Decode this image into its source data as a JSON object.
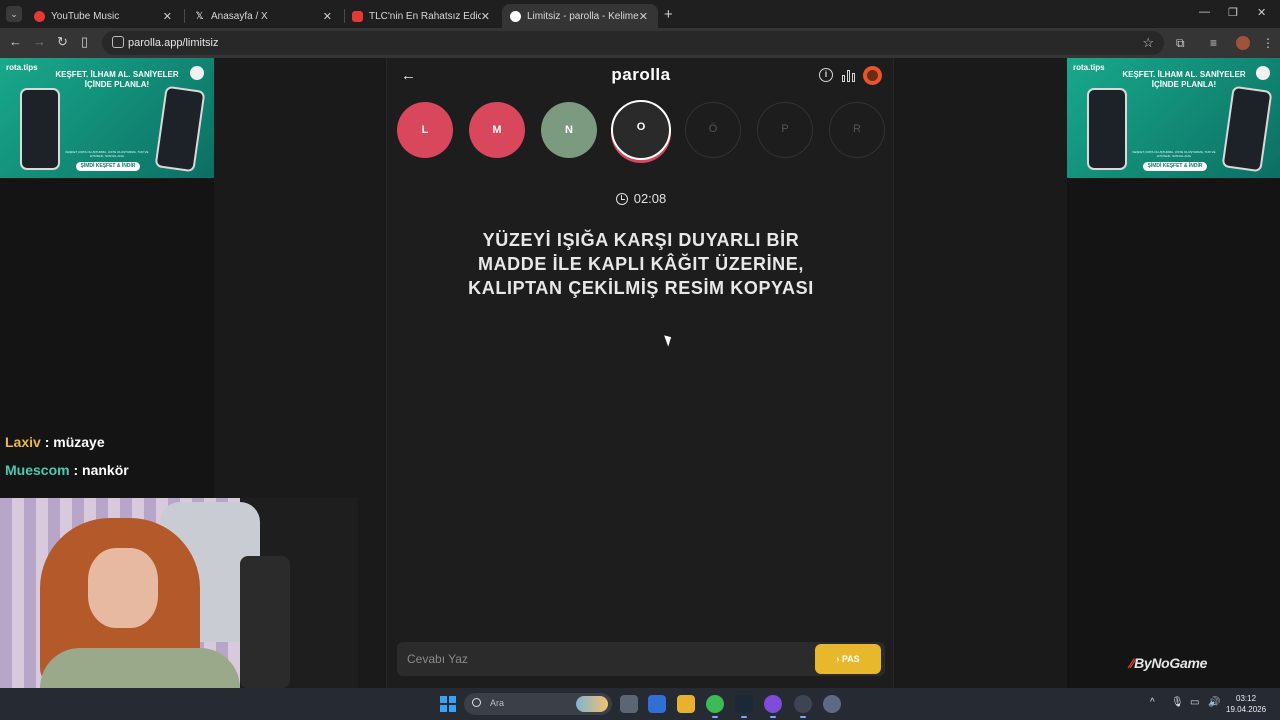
{
  "browser": {
    "tabs": [
      {
        "title": "YouTube Music",
        "color": "#e53935"
      },
      {
        "title": "Anasayfa / X",
        "color": "#ffffff"
      },
      {
        "title": "TLC'nin En Rahatsız Edici Progr",
        "color": "#e53935"
      },
      {
        "title": "Limitsiz - parolla - Kelime oyunu",
        "color": "#ffffff"
      }
    ],
    "url": "parolla.app/limitsiz"
  },
  "ad": {
    "brand": "rota.tips",
    "headline": "KEŞFET. İLHAM AL. SANİYELER İÇİNDE PLANLA!",
    "sub": "KEŞFET, ROTA OLUŞTURMA, LİSTE OLUŞTURMA, TUR VE ETKİNLİK, SOSYAL ANG",
    "cta": "ŞİMDİ KEŞFET & İNDİR"
  },
  "game": {
    "logo": "parolla",
    "letters": [
      {
        "letter": "L",
        "state": "wrong"
      },
      {
        "letter": "M",
        "state": "wrong"
      },
      {
        "letter": "N",
        "state": "right"
      },
      {
        "letter": "O",
        "state": "current"
      },
      {
        "letter": "Ö",
        "state": "pending"
      },
      {
        "letter": "P",
        "state": "pending"
      },
      {
        "letter": "R",
        "state": "pending"
      }
    ],
    "timer": "02:08",
    "question_lines": [
      "YÜZEYİ IŞIĞA KARŞI DUYARLI BİR",
      "MADDE İLE KAPLI KÂĞIT ÜZERİNE,",
      "KALIPTAN ÇEKİLMİŞ RESİM KOPYASI"
    ],
    "answer_placeholder": "Cevabı Yaz",
    "pass_label": "PAS",
    "colors": {
      "wrong": "#d9475c",
      "right": "#7b9a80",
      "pass": "#e7b72c"
    }
  },
  "chat": [
    {
      "user": "Laxiv",
      "sep": " : ",
      "message": "müzaye"
    },
    {
      "user": "Muescom",
      "sep": " : ",
      "message": "nankör"
    }
  ],
  "watermark": "ByNoGame",
  "taskbar": {
    "search_placeholder": "Ara",
    "time": "03:12",
    "date": "19.04.2026"
  }
}
